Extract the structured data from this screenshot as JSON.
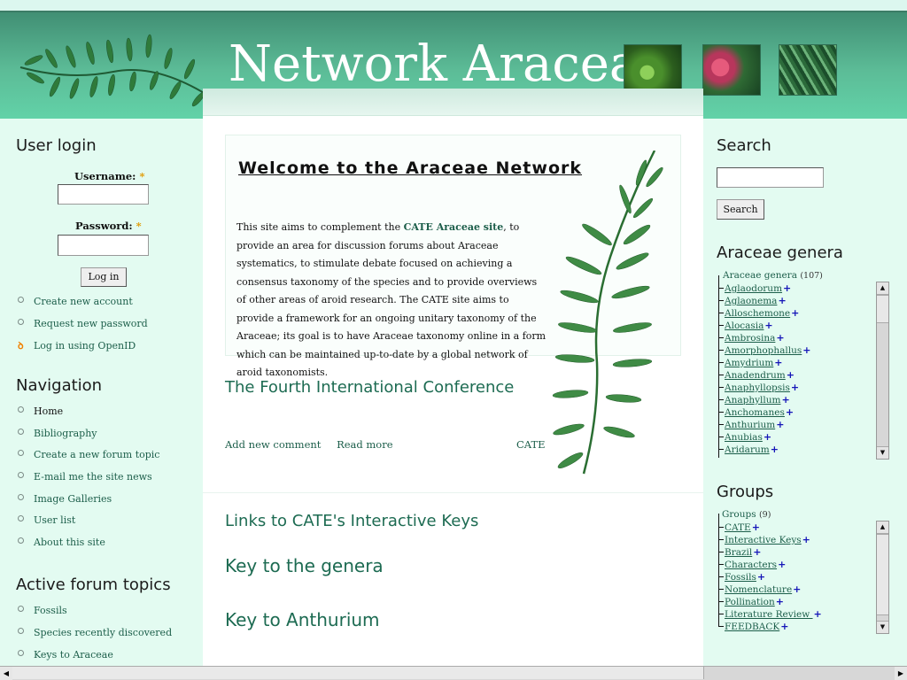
{
  "header": {
    "site_title": "Network Araceae"
  },
  "welcome": {
    "title": "Welcome to the Araceae Network",
    "text_before_link": "This site aims to complement the ",
    "link_text": "CATE Araceae site",
    "text_after_link": ", to provide an area for discussion forums about Araceae systematics, to stimulate debate focused on achieving a consensus taxonomy of the species and to provide overviews of other areas of aroid research. The CATE site aims to provide a framework for an ongoing unitary taxonomy of the Araceae; its goal is to have Araceae taxonomy online in a form which can be maintained up-to-date by a global network of aroid taxonomists."
  },
  "conference": {
    "title": "The Fourth International Conference",
    "add_comment": "Add new comment",
    "read_more": "Read more",
    "cate_link": "CATE"
  },
  "keys": {
    "title": "Links to CATE's Interactive Keys",
    "key_genera": "Key to the genera",
    "key_anthurium": "Key to Anthurium"
  },
  "user_login": {
    "heading": "User login",
    "username_label": "Username:",
    "password_label": "Password:",
    "required_mark": "*",
    "login_button": "Log in",
    "links": [
      "Create new account",
      "Request new password",
      "Log in using OpenID"
    ]
  },
  "navigation": {
    "heading": "Navigation",
    "items": [
      "Home",
      "Bibliography",
      "Create a new forum topic",
      "E-mail me the site news",
      "Image Galleries",
      "User list",
      "About this site"
    ]
  },
  "forum_topics": {
    "heading": "Active forum topics",
    "items": [
      "Fossils",
      "Species recently discovered",
      "Keys to Araceae"
    ]
  },
  "search": {
    "heading": "Search",
    "button": "Search",
    "value": ""
  },
  "genera": {
    "heading": "Araceae genera",
    "root_label": "Araceae genera",
    "root_count": "(107)",
    "items": [
      "Aglaodorum",
      "Aglaonema",
      "Alloschemone",
      "Alocasia",
      "Ambrosina",
      "Amorphophallus",
      "Amydrium",
      "Anadendrum",
      "Anaphyllopsis",
      "Anaphyllum",
      "Anchomanes",
      "Anthurium",
      "Anubias",
      "Aridarum"
    ]
  },
  "groups": {
    "heading": "Groups",
    "root_label": "Groups",
    "root_count": "(9)",
    "items": [
      "CATE",
      "Interactive Keys",
      "Brazil",
      "Characters",
      "Fossils",
      "Nomenclature",
      "Pollination",
      "Literature Review ",
      "FEEDBACK"
    ]
  },
  "colors": {
    "header_dark": "#418f74",
    "header_light": "#62d2a8",
    "page_background": "#e3fbf1",
    "link_green": "#1c5e4a",
    "heading_green": "#1d6b52",
    "plus_blue": "#1414b8"
  }
}
